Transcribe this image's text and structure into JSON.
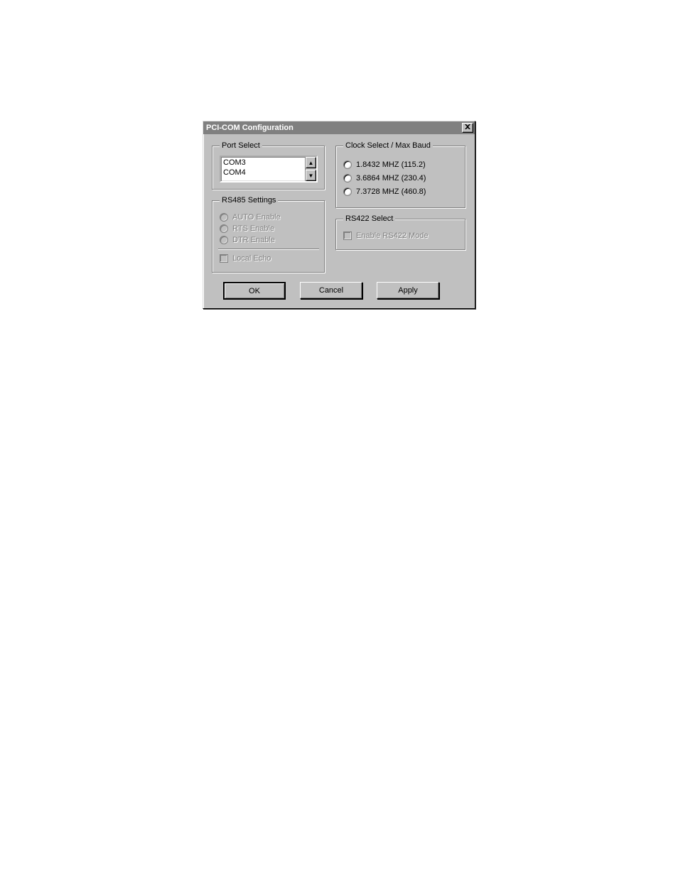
{
  "dialog": {
    "title": "PCI-COM Configuration",
    "close_label": "X"
  },
  "port_select": {
    "legend": "Port Select",
    "items": [
      "COM3",
      "COM4"
    ]
  },
  "rs485": {
    "legend": "RS485 Settings",
    "options": {
      "auto": "AUTO Enable",
      "rts": "RTS Enable",
      "dtr": "DTR Enable"
    },
    "local_echo": "Local Echo",
    "enabled": false
  },
  "clock": {
    "legend": "Clock Select / Max Baud",
    "options": [
      "1.8432 MHZ (115.2)",
      "3.6864 MHZ (230.4)",
      "7.3728 MHZ (460.8)"
    ]
  },
  "rs422": {
    "legend": "RS422 Select",
    "checkbox": "Enable RS422 Mode",
    "enabled": false
  },
  "buttons": {
    "ok": "OK",
    "cancel": "Cancel",
    "apply": "Apply"
  }
}
